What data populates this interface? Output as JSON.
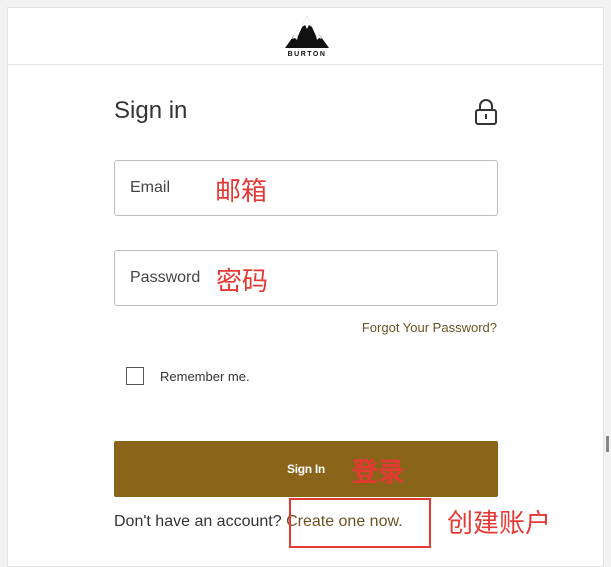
{
  "header": {
    "brand": "BURTON",
    "logo_icon": "burton-mountain-logo"
  },
  "form": {
    "title": "Sign in",
    "lock_icon": "lock-icon",
    "email_label": "Email",
    "password_label": "Password",
    "forgot_link": "Forgot Your Password?",
    "remember_label": "Remember me.",
    "remember_checked": false,
    "signin_button": "Sign In",
    "no_account_text": "Don't have an account? ",
    "create_link": "Create one now."
  },
  "annotations": {
    "email": "邮箱",
    "password": "密码",
    "signin": "登录",
    "create_account": "创建账户",
    "color": "#e53935"
  },
  "colors": {
    "button": "#8a6419",
    "link": "#6b5320"
  }
}
